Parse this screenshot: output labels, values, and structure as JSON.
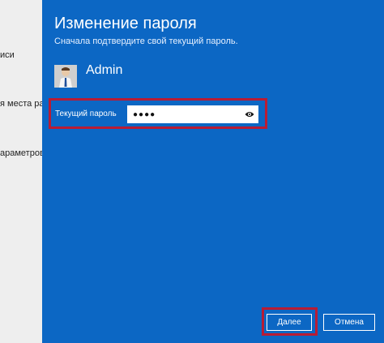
{
  "background": {
    "snippets": [
      "иси",
      "я места рабо",
      "араметров"
    ]
  },
  "dialog": {
    "title": "Изменение пароля",
    "subtitle": "Сначала подтвердите свой текущий пароль.",
    "user": {
      "name": "Admin",
      "avatar_icon": "user-avatar"
    },
    "current_password": {
      "label": "Текущий пароль",
      "masked_value": "●●●●",
      "reveal_icon": "eye-icon"
    },
    "buttons": {
      "next": "Далее",
      "cancel": "Отмена"
    }
  },
  "colors": {
    "dialog_bg": "#0c67c4",
    "highlight": "#b81c35",
    "background": "#eeeeee"
  }
}
